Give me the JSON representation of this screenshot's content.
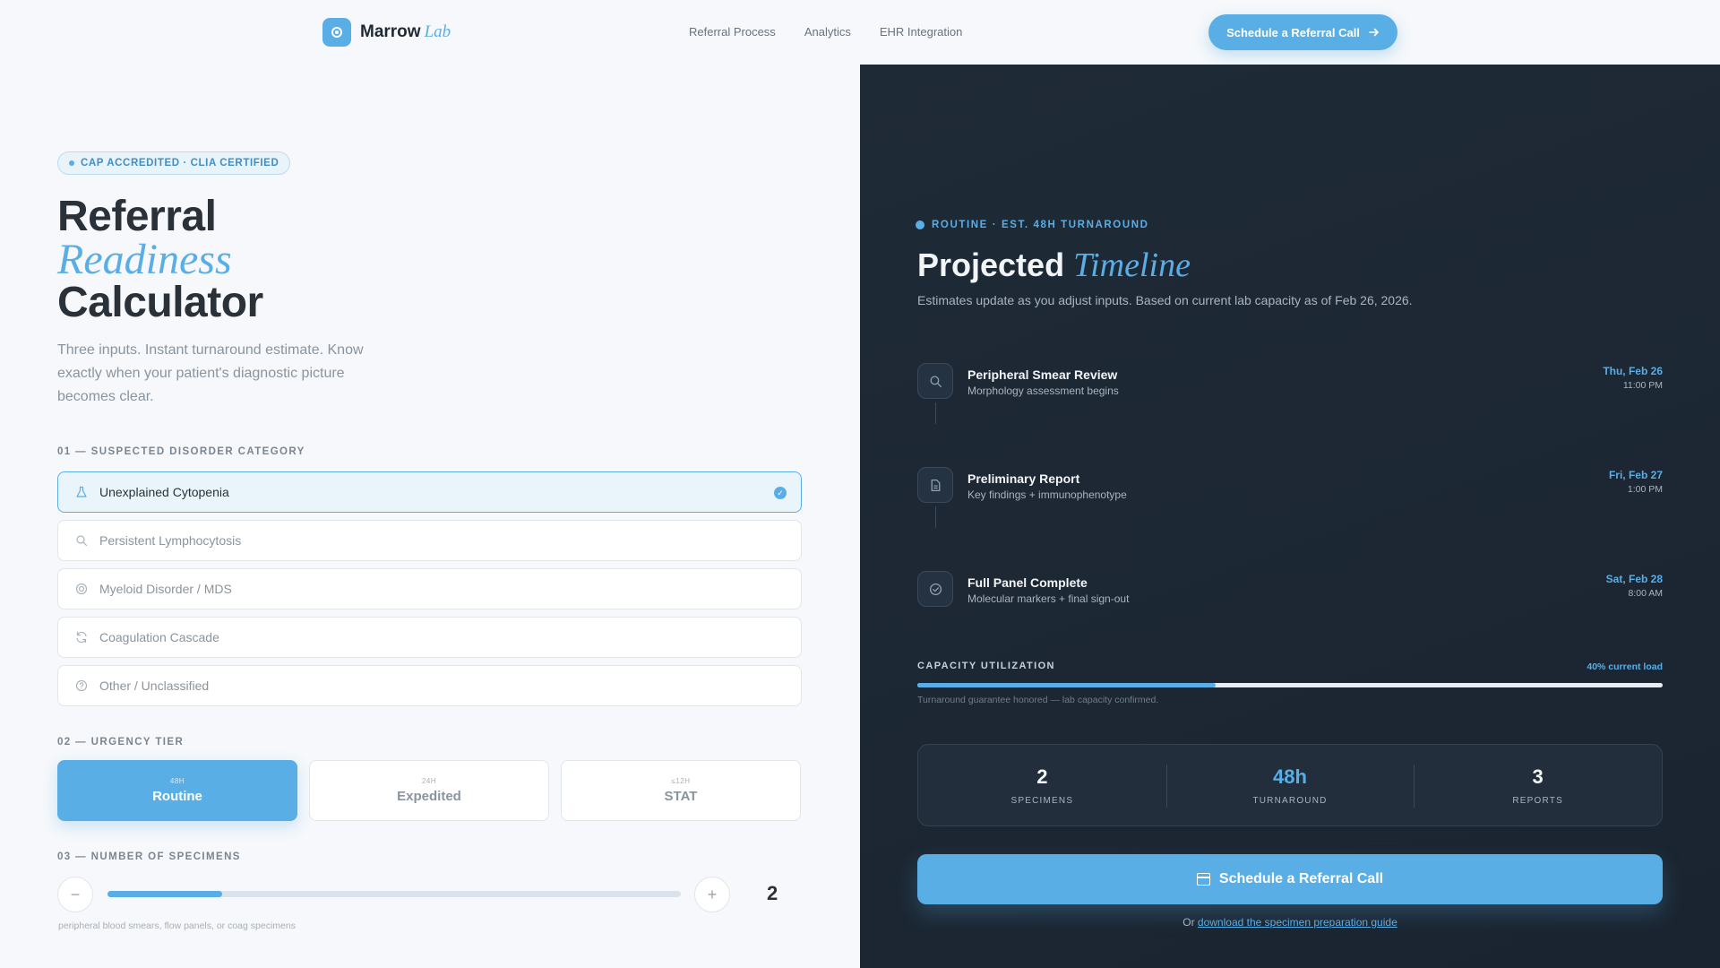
{
  "brand": {
    "name": "Marrow",
    "accent": "Lab"
  },
  "nav": {
    "links": [
      "Referral Process",
      "Analytics",
      "EHR Integration"
    ],
    "cta_label": "Schedule a Referral Call"
  },
  "hero": {
    "badge": "CAP ACCREDITED · CLIA CERTIFIED",
    "title_line1": "Referral",
    "title_italic": "Readiness",
    "title_line3": "Calculator",
    "subtitle": "Three inputs. Instant turnaround estimate. Know exactly when your patient's diagnostic picture becomes clear."
  },
  "section1": {
    "label": "01 — SUSPECTED DISORDER CATEGORY",
    "options": [
      {
        "label": "Unexplained Cytopenia",
        "icon": "flask-icon",
        "selected": true
      },
      {
        "label": "Persistent Lymphocytosis",
        "icon": "search-icon",
        "selected": false
      },
      {
        "label": "Myeloid Disorder / MDS",
        "icon": "cell-icon",
        "selected": false
      },
      {
        "label": "Coagulation Cascade",
        "icon": "refresh-icon",
        "selected": false
      },
      {
        "label": "Other / Unclassified",
        "icon": "help-icon",
        "selected": false
      }
    ]
  },
  "section2": {
    "label": "02 — URGENCY TIER",
    "tiers": [
      {
        "small": "48H",
        "label": "Routine",
        "active": true
      },
      {
        "small": "24H",
        "label": "Expedited",
        "active": false
      },
      {
        "small": "≤12H",
        "label": "STAT",
        "active": false
      }
    ]
  },
  "section3": {
    "label": "03 — NUMBER OF SPECIMENS",
    "minus": "−",
    "plus": "+",
    "value": "2",
    "slider_fraction": 0.2,
    "hint": "peripheral blood smears, flow panels, or coag specimens"
  },
  "panel": {
    "eyebrow": "ROUTINE · EST. 48H TURNAROUND",
    "title": "Projected",
    "title_italic": "Timeline",
    "subtitle": "Estimates update as you adjust inputs. Based on current lab capacity as of Feb 26, 2026.",
    "steps": [
      {
        "title": "Peripheral Smear Review",
        "desc": "Morphology assessment begins",
        "date": "Thu, Feb 26",
        "time": "11:00 PM",
        "icon": "search-icon"
      },
      {
        "title": "Preliminary Report",
        "desc": "Key findings + immunophenotype",
        "date": "Fri, Feb 27",
        "time": "1:00 PM",
        "icon": "document-icon"
      },
      {
        "title": "Full Panel Complete",
        "desc": "Molecular markers + final sign-out",
        "date": "Sat, Feb 28",
        "time": "8:00 AM",
        "icon": "check-circle-icon"
      }
    ],
    "capacity": {
      "label": "CAPACITY UTILIZATION",
      "value_text": "40% current load",
      "fraction": 0.4,
      "note": "Turnaround guarantee honored — lab capacity confirmed."
    },
    "stats": [
      {
        "value": "2",
        "label": "SPECIMENS",
        "accent": false
      },
      {
        "value": "48h",
        "label": "TURNAROUND",
        "accent": true
      },
      {
        "value": "3",
        "label": "REPORTS",
        "accent": false
      }
    ],
    "cta_label": "Schedule a Referral Call",
    "guide_prefix": "Or",
    "guide_link": "download the specimen preparation guide"
  },
  "colors": {
    "accent": "#5aaee6",
    "panel_bg": "#1f2a37",
    "text_dark": "#2a3138"
  }
}
